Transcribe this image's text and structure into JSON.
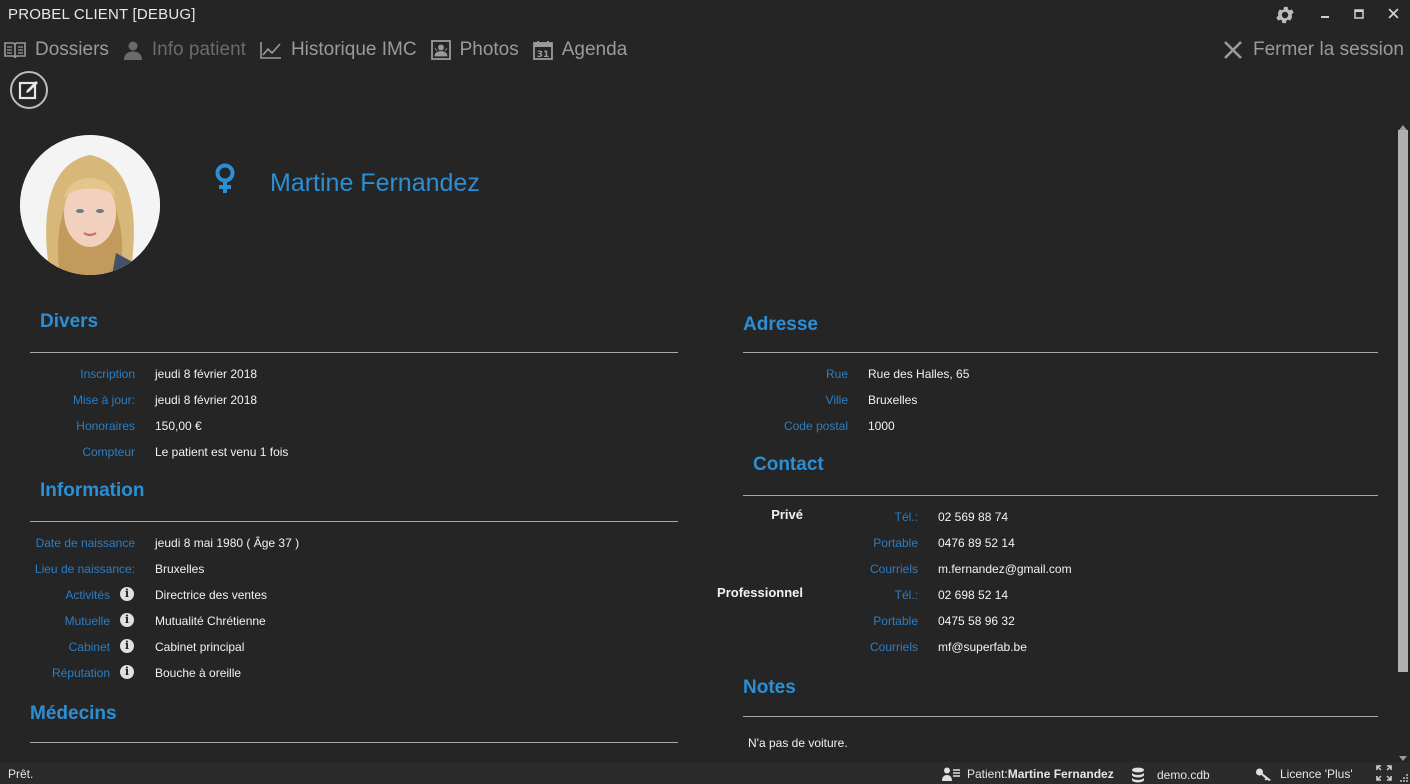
{
  "window": {
    "title": "PROBEL CLIENT [DEBUG]"
  },
  "nav": {
    "items": [
      {
        "label": "Dossiers",
        "icon": "book-icon"
      },
      {
        "label": "Info patient",
        "icon": "user-icon"
      },
      {
        "label": "Historique IMC",
        "icon": "line-chart-icon"
      },
      {
        "label": "Photos",
        "icon": "photo-icon"
      },
      {
        "label": "Agenda",
        "icon": "calendar-icon"
      }
    ],
    "calendar_day": "31",
    "logout_label": "Fermer la session"
  },
  "patient": {
    "name": "Martine Fernandez",
    "gender": "female"
  },
  "divers": {
    "title": "Divers",
    "rows": [
      {
        "label": "Inscription",
        "value": "jeudi 8 février 2018"
      },
      {
        "label": "Mise à jour:",
        "value": "jeudi 8 février 2018"
      },
      {
        "label": "Honoraires",
        "value": "150,00 €"
      },
      {
        "label": "Compteur",
        "value": "Le patient est venu 1 fois"
      }
    ]
  },
  "information": {
    "title": "Information",
    "rows": [
      {
        "label": "Date de naissance",
        "value": "jeudi 8 mai 1980 ( Âge 37 )"
      },
      {
        "label": "Lieu de naissance:",
        "value": "Bruxelles"
      },
      {
        "label": "Activités",
        "value": "Directrice des ventes"
      },
      {
        "label": "Mutuelle",
        "value": "Mutualité Chrétienne"
      },
      {
        "label": "Cabinet",
        "value": "Cabinet principal"
      },
      {
        "label": "Réputation",
        "value": "Bouche à oreille"
      }
    ],
    "info_glyph": "i"
  },
  "medecins": {
    "title": "Médecins"
  },
  "adresse": {
    "title": "Adresse",
    "rows": [
      {
        "label": "Rue",
        "value": "Rue des Halles, 65"
      },
      {
        "label": "Ville",
        "value": "Bruxelles"
      },
      {
        "label": "Code postal",
        "value": "1000"
      }
    ]
  },
  "contact": {
    "title": "Contact",
    "prive": {
      "heading": "Privé",
      "rows": [
        {
          "label": "Tél.:",
          "value": "02 569 88 74"
        },
        {
          "label": "Portable",
          "value": "0476 89 52 14"
        },
        {
          "label": "Courriels",
          "value": "m.fernandez@gmail.com"
        }
      ]
    },
    "pro": {
      "heading": "Professionnel",
      "rows": [
        {
          "label": "Tél.:",
          "value": "02 698 52 14"
        },
        {
          "label": "Portable",
          "value": "0475 58 96 32"
        },
        {
          "label": "Courriels",
          "value": "mf@superfab.be"
        }
      ]
    }
  },
  "notes": {
    "title": "Notes",
    "text": "N'a pas de voiture."
  },
  "status": {
    "ready": "Prêt.",
    "patient_prefix": "Patient: ",
    "patient_name": "Martine Fernandez",
    "database": "demo.cdb",
    "license": "Licence 'Plus'"
  },
  "colors": {
    "accent": "#2b8fd6",
    "background": "#252526",
    "label": "#2b7ec4"
  }
}
